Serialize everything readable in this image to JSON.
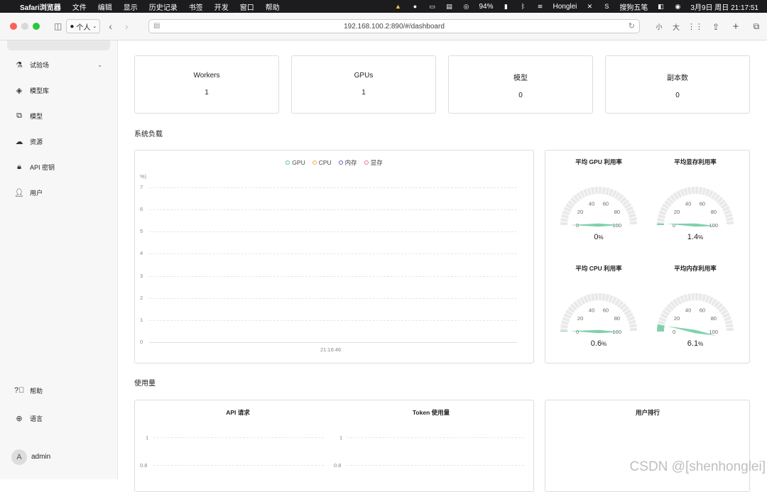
{
  "menubar": {
    "app": "Safari浏览器",
    "items": [
      "文件",
      "编辑",
      "显示",
      "历史记录",
      "书签",
      "开发",
      "窗口",
      "帮助"
    ],
    "battery": "94%",
    "user": "Honglei",
    "ime": "搜狗五笔",
    "datetime": "3月9日 周日  21:17:51"
  },
  "browser": {
    "profile": "个人",
    "url": "192.168.100.2:890/#/dashboard",
    "font_small": "小",
    "font_large": "大"
  },
  "sidebar": {
    "items": [
      {
        "label": "试验场",
        "icon": "flask-icon"
      },
      {
        "label": "模型库",
        "icon": "layers-icon"
      },
      {
        "label": "模型",
        "icon": "model-icon"
      },
      {
        "label": "资源",
        "icon": "cloud-icon"
      },
      {
        "label": "API 密钥",
        "icon": "lock-icon"
      },
      {
        "label": "用户",
        "icon": "user-icon"
      }
    ],
    "help": "帮助",
    "language": "语言",
    "user": {
      "initial": "A",
      "name": "admin"
    }
  },
  "stats": [
    {
      "title": "Workers",
      "value": "1"
    },
    {
      "title": "GPUs",
      "value": "1"
    },
    {
      "title": "模型",
      "value": "0"
    },
    {
      "title": "副本数",
      "value": "0"
    }
  ],
  "load_section": "系统负载",
  "chart_data": {
    "type": "line",
    "legend": [
      {
        "name": "GPU",
        "color": "#5ec29a"
      },
      {
        "name": "CPU",
        "color": "#f5b040"
      },
      {
        "name": "内存",
        "color": "#6a5bc2"
      },
      {
        "name": "显存",
        "color": "#e06fa8"
      }
    ],
    "ylabel": "%)",
    "yticks": [
      "7",
      "6",
      "5",
      "4",
      "3",
      "2",
      "1",
      "0"
    ],
    "ylim": [
      0,
      7
    ],
    "xticks": [
      "21:16:46"
    ],
    "grid": true,
    "legend_position": "top-center"
  },
  "gauges": [
    {
      "title": "平均 GPU 利用率",
      "value": 0,
      "display": "0",
      "unit": "%"
    },
    {
      "title": "平均显存利用率",
      "value": 1.4,
      "display": "1.4",
      "unit": "%"
    },
    {
      "title": "平均 CPU 利用率",
      "value": 0.6,
      "display": "0.6",
      "unit": "%"
    },
    {
      "title": "平均内存利用率",
      "value": 6.1,
      "display": "6.1",
      "unit": "%"
    }
  ],
  "gauge_ticks": [
    "0",
    "20",
    "40",
    "60",
    "80",
    "100"
  ],
  "usage_section": "使用量",
  "usage": {
    "api_title": "API 请求",
    "token_title": "Token 使用量",
    "yticks": [
      "1",
      "0.8"
    ],
    "ranking_title": "用户排行"
  },
  "watermark": "CSDN @[shenhonglei]",
  "colors": {
    "accent": "#7fd1ac",
    "gauge_track": "#e9e9e9"
  }
}
